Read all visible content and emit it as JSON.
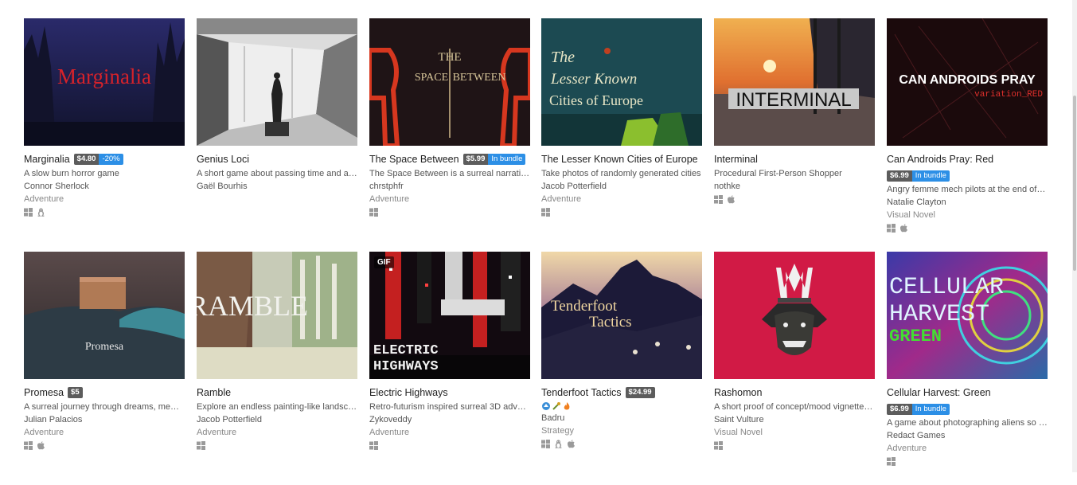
{
  "games": [
    {
      "title": "Marginalia",
      "price": "$4.80",
      "sale": "-20%",
      "desc": "A slow burn horror game",
      "author": "Connor Sherlock",
      "genre": "Adventure",
      "platforms": [
        "windows",
        "linux"
      ],
      "art": "Marginalia"
    },
    {
      "title": "Genius Loci",
      "desc": "A short game about passing time and arch...",
      "author": "Gaël Bourhis",
      "platforms": []
    },
    {
      "title": "The Space Between",
      "price": "$5.99",
      "sale": "In bundle",
      "desc": "The Space Between is a surreal narrative ...",
      "author": "chrstphfr",
      "genre": "Adventure",
      "platforms": [
        "windows"
      ],
      "art_line1": "THE",
      "art_line2a": "SPACE",
      "art_line2b": "BETWEEN"
    },
    {
      "title": "The Lesser Known Cities of Europe",
      "desc": "Take photos of randomly generated cities",
      "author": "Jacob Potterfield",
      "genre": "Adventure",
      "platforms": [
        "windows"
      ],
      "art_line1": "The",
      "art_line2": "Lesser Known",
      "art_line3": "Cities of Europe"
    },
    {
      "title": "Interminal",
      "desc": "Procedural First-Person Shopper",
      "author": "nothke",
      "platforms": [
        "windows",
        "mac"
      ],
      "art": "INTERMINAL"
    },
    {
      "title": "Can Androids Pray: Red",
      "price": "$6.99",
      "sale": "In bundle",
      "desc": "Angry femme mech pilots at the end of th...",
      "author": "Natalie Clayton",
      "genre": "Visual Novel",
      "platforms": [
        "windows",
        "mac"
      ],
      "art_line1": "CAN ANDROIDS PRAY",
      "art_line2": "variation_RED"
    },
    {
      "title": "Promesa",
      "price": "$5",
      "desc": "A surreal journey through dreams, memori...",
      "author": "Julian Palacios",
      "genre": "Adventure",
      "platforms": [
        "windows",
        "mac"
      ],
      "art": "Promesa"
    },
    {
      "title": "Ramble",
      "desc": "Explore an endless painting-like landscape",
      "author": "Jacob Potterfield",
      "genre": "Adventure",
      "platforms": [
        "windows"
      ],
      "art": "RAMBLE"
    },
    {
      "title": "Electric Highways",
      "desc": "Retro-futurism inspired surreal 3D advent...",
      "author": "Zykoveddy",
      "genre": "Adventure",
      "platforms": [
        "windows"
      ],
      "gif": "GIF",
      "art_line1": "ELECTRIC",
      "art_line2": "HIGHWAYS"
    },
    {
      "title": "Tenderfoot Tactics",
      "price": "$24.99",
      "author": "Badru",
      "genre": "Strategy",
      "platforms": [
        "windows",
        "linux",
        "mac"
      ],
      "extra_icons": [
        "shark-icon",
        "weapon-icon",
        "fire-icon"
      ],
      "art_line1": "Tenderfoot",
      "art_line2": "Tactics"
    },
    {
      "title": "Rashomon",
      "desc": "A short proof of concept/mood vignette/l...",
      "author": "Saint Vulture",
      "genre": "Visual Novel",
      "platforms": [
        "windows"
      ]
    },
    {
      "title": "Cellular Harvest: Green",
      "price": "$6.99",
      "sale": "In bundle",
      "desc": "A game about photographing aliens so tha...",
      "author": "Redact Games",
      "genre": "Adventure",
      "platforms": [
        "windows"
      ],
      "art_line1": "CELLULAR",
      "art_line2": "HARVEST",
      "art_line3": "GREEN"
    }
  ]
}
